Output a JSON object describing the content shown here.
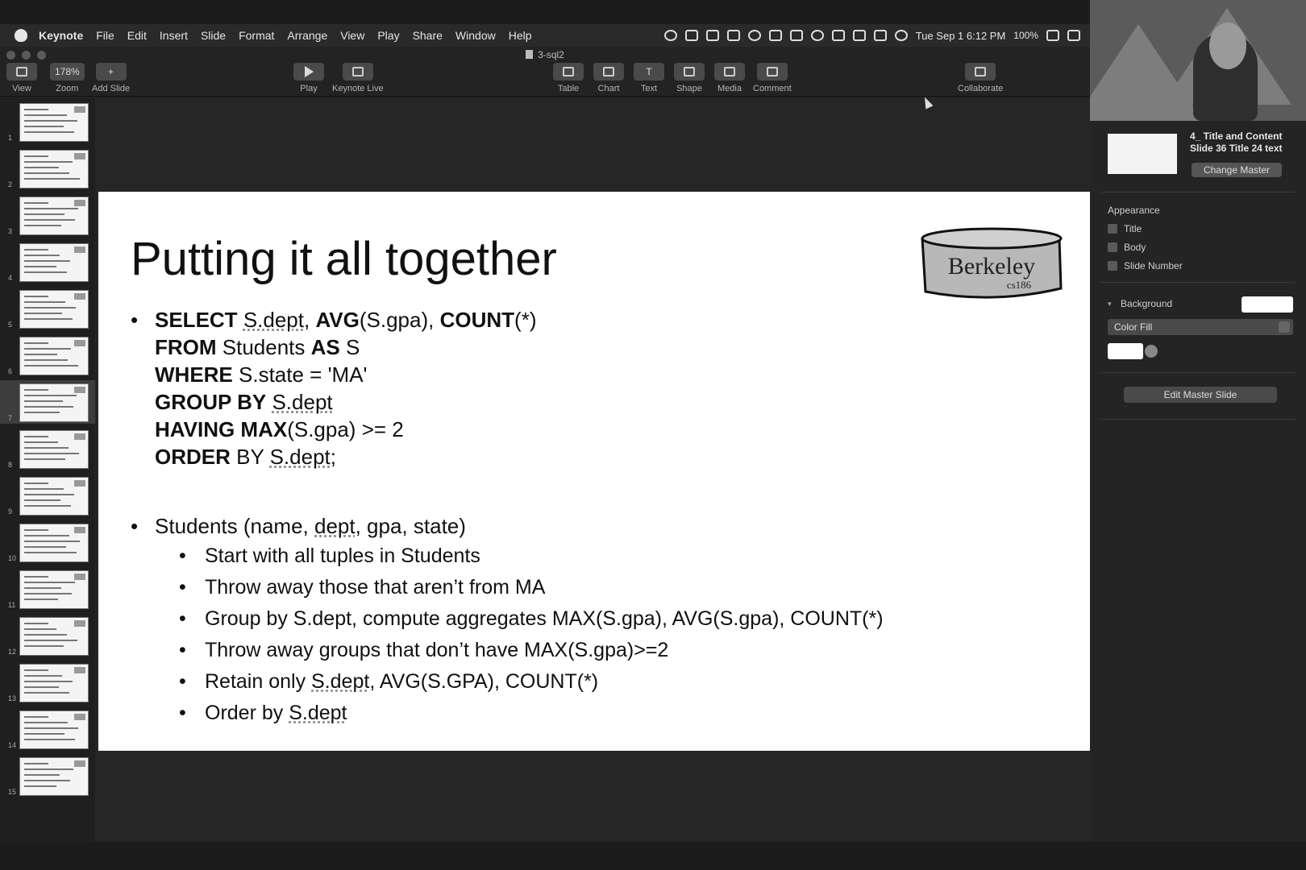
{
  "menubar": {
    "app_name": "Keynote",
    "items": [
      "File",
      "Edit",
      "Insert",
      "Slide",
      "Format",
      "Arrange",
      "View",
      "Play",
      "Share",
      "Window",
      "Help"
    ],
    "datetime": "Tue Sep 1  6:12 PM",
    "battery": "100%"
  },
  "window": {
    "document_title": "3-sql2"
  },
  "toolbar": {
    "view": "View",
    "zoom": "Zoom",
    "zoom_value": "178%",
    "add_slide": "Add Slide",
    "play": "Play",
    "keynote_live": "Keynote Live",
    "table": "Table",
    "chart": "Chart",
    "text": "Text",
    "shape": "Shape",
    "media": "Media",
    "comment": "Comment",
    "collaborate": "Collaborate"
  },
  "navigator": {
    "slide_numbers": [
      "1",
      "2",
      "3",
      "4",
      "5",
      "6",
      "7",
      "8",
      "9",
      "10",
      "11",
      "12",
      "13",
      "14",
      "15"
    ],
    "selected": 7
  },
  "slide": {
    "title": "Putting it all together",
    "logo_text": "Berkeley",
    "logo_subtext": "cs186",
    "sql": {
      "kw_select": "SELECT",
      "sdept1": "S.dept",
      "comma1": ",",
      "kw_avg": "AVG",
      "avg_arg": "(S.gpa),",
      "kw_count": "COUNT",
      "count_arg": "(*)",
      "kw_from": "FROM",
      "from_table": "Students",
      "kw_as": "AS",
      "alias": "S",
      "kw_where": "WHERE",
      "where_cond": "S.state = 'MA'",
      "kw_group": "GROUP BY",
      "sdept2": "S.dept",
      "kw_having": "HAVING MAX",
      "having_cond": "(S.gpa) >= 2",
      "kw_order": "ORDER",
      "order_by": "BY",
      "sdept3": "S.dept",
      "semi": ";"
    },
    "schema": {
      "prefix": "Students (name, ",
      "dept": "dept",
      "suffix": ", gpa, state)"
    },
    "steps": [
      "Start with all tuples in Students",
      "Throw away those that aren’t from MA",
      "Group by S.dept, compute aggregates MAX(S.gpa), AVG(S.gpa), COUNT(*)",
      "Throw away groups that don’t have MAX(S.gpa)>=2"
    ],
    "step5_prefix": "Retain only ",
    "step5_dept": "S.dept",
    "step5_suffix": ", AVG(S.GPA), COUNT(*)",
    "step6_prefix": "Order by ",
    "step6_dept": "S.dept",
    "bullet": "•"
  },
  "inspector": {
    "master_name_line1": "4_ Title and Content",
    "master_name_line2": "Slide 36 Title 24 text",
    "change_master": "Change Master",
    "appearance": "Appearance",
    "title_chk": "Title",
    "body_chk": "Body",
    "slide_number_chk": "Slide Number",
    "background": "Background",
    "color_fill": "Color Fill",
    "edit_master": "Edit Master Slide"
  }
}
